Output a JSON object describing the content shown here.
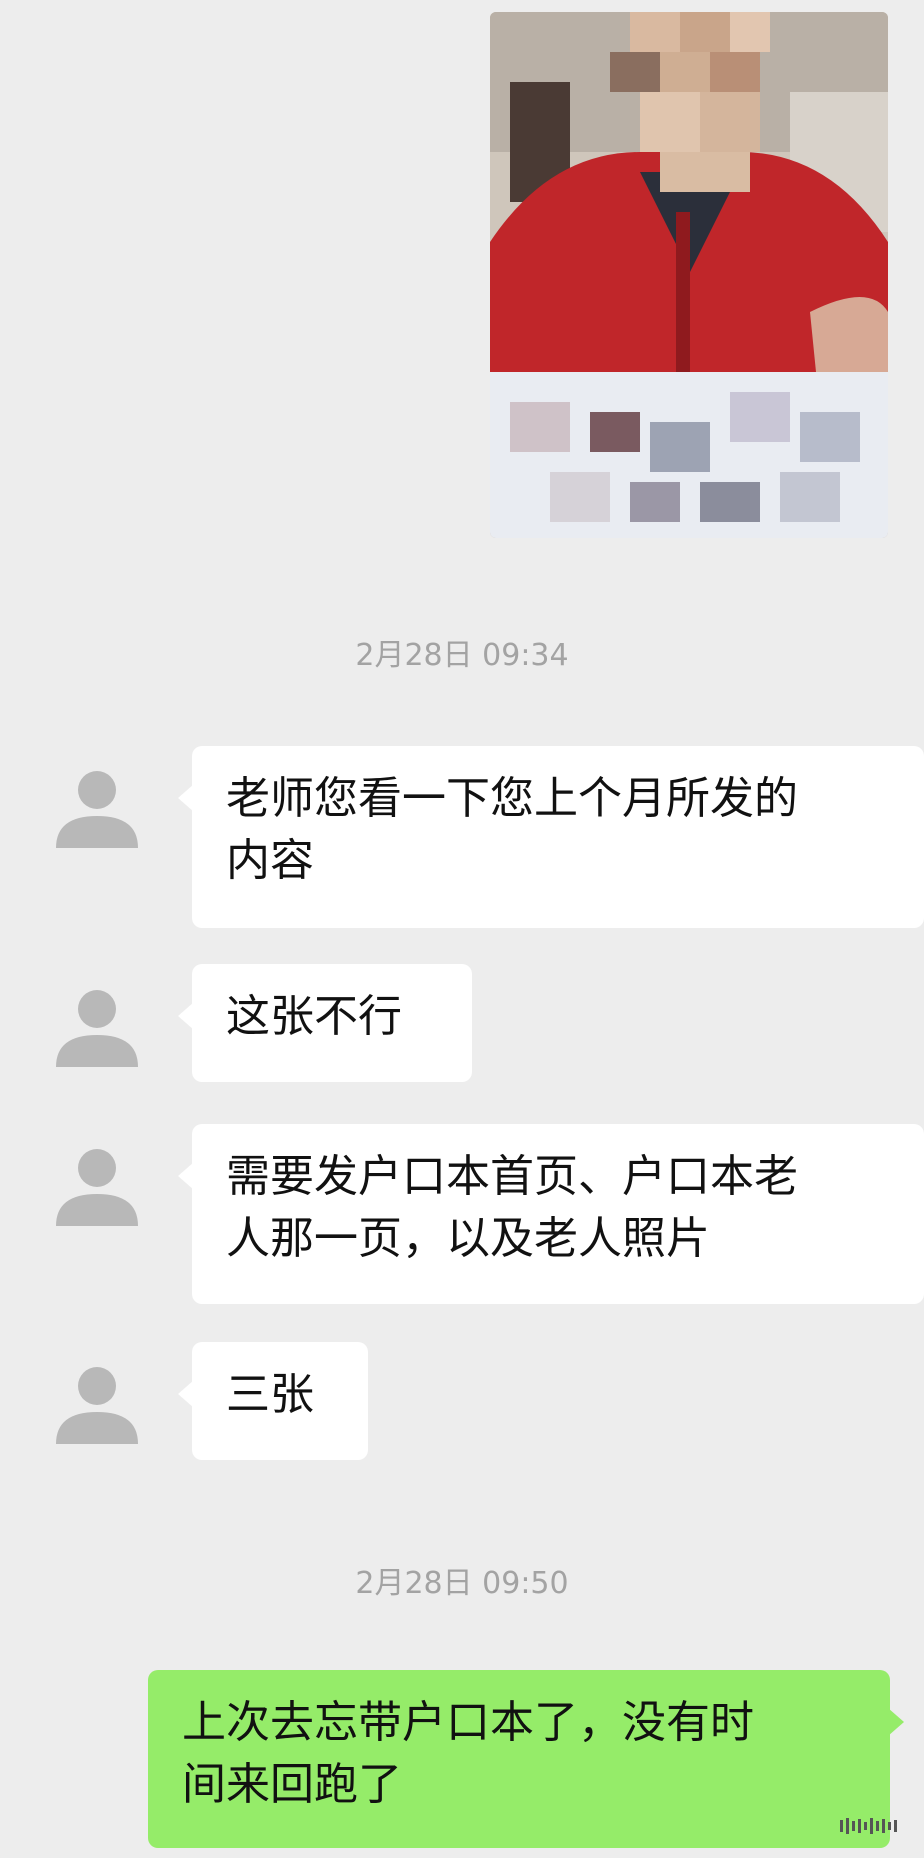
{
  "messages": {
    "photo": {
      "icon": "blurred-photo",
      "alt": ""
    },
    "timestamp_1": "2月28日 09:34",
    "incoming": [
      {
        "text_line1": "老师您看一下您上个月所发的",
        "text_line2": "内容"
      },
      {
        "text": "这张不行"
      },
      {
        "text_line1": "需要发户口本首页、户口本老",
        "text_line2": "人那一页，以及老人照片"
      },
      {
        "text": "三张"
      }
    ],
    "timestamp_2": "2月28日 09:50",
    "outgoing": [
      {
        "text_line1": "上次去忘带户口本了，没有时",
        "text_line2": "间来回跑了"
      }
    ]
  },
  "colors": {
    "background": "#ededed",
    "incoming_bubble": "#ffffff",
    "outgoing_bubble": "#95ec69",
    "timestamp": "#a3a3a3",
    "avatar": "#b8b8b8"
  },
  "icons": {
    "avatar": "default-user-avatar-icon"
  }
}
